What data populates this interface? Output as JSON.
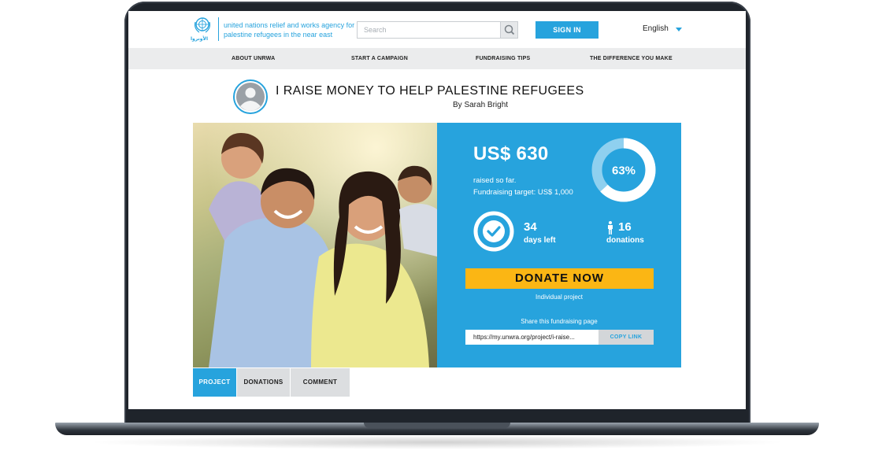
{
  "header": {
    "org_arabic": "الأونروا",
    "org_name_line1": "united nations relief and works agency for",
    "org_name_line2": "palestine refugees in the near east",
    "search_placeholder": "Search",
    "signin_label": "SIGN IN",
    "language": "English"
  },
  "nav": {
    "items": [
      {
        "label": "ABOUT UNRWA"
      },
      {
        "label": "START A CAMPAIGN"
      },
      {
        "label": "FUNDRAISING TIPS"
      },
      {
        "label": "THE DIFFERENCE YOU MAKE"
      }
    ]
  },
  "campaign": {
    "title": "I RAISE MONEY TO HELP PALESTINE REFUGEES",
    "author": "By Sarah Bright",
    "amount": "US$ 630",
    "raised_text": "raised so far.",
    "target_text": "Fundraising target: US$ 1,000",
    "progress_percent": 63,
    "progress_label": "63%",
    "days_left_value": "34",
    "days_left_label": "days left",
    "donations_value": "16",
    "donations_label": "donations",
    "donate_label": "DONATE NOW",
    "project_type": "Individual project",
    "share_label": "Share this fundraising page",
    "share_url": "https://my.unwra.org/project/i-raise...",
    "copy_label": "COPY LINK"
  },
  "tabs": [
    {
      "label": "PROJECT",
      "active": true
    },
    {
      "label": "DONATIONS",
      "active": false
    },
    {
      "label": "COMMENT",
      "active": false
    }
  ],
  "colors": {
    "brand_blue": "#27a3dd",
    "donate_yellow": "#fbb614",
    "nav_gray": "#ebeced",
    "donut_track": "#8fd0ef"
  },
  "icons": {
    "search": "search-icon",
    "caret": "chevron-down-icon",
    "check": "check-circle-icon",
    "person": "person-icon",
    "avatar": "user-avatar-icon",
    "emblem": "un-emblem-logo"
  }
}
